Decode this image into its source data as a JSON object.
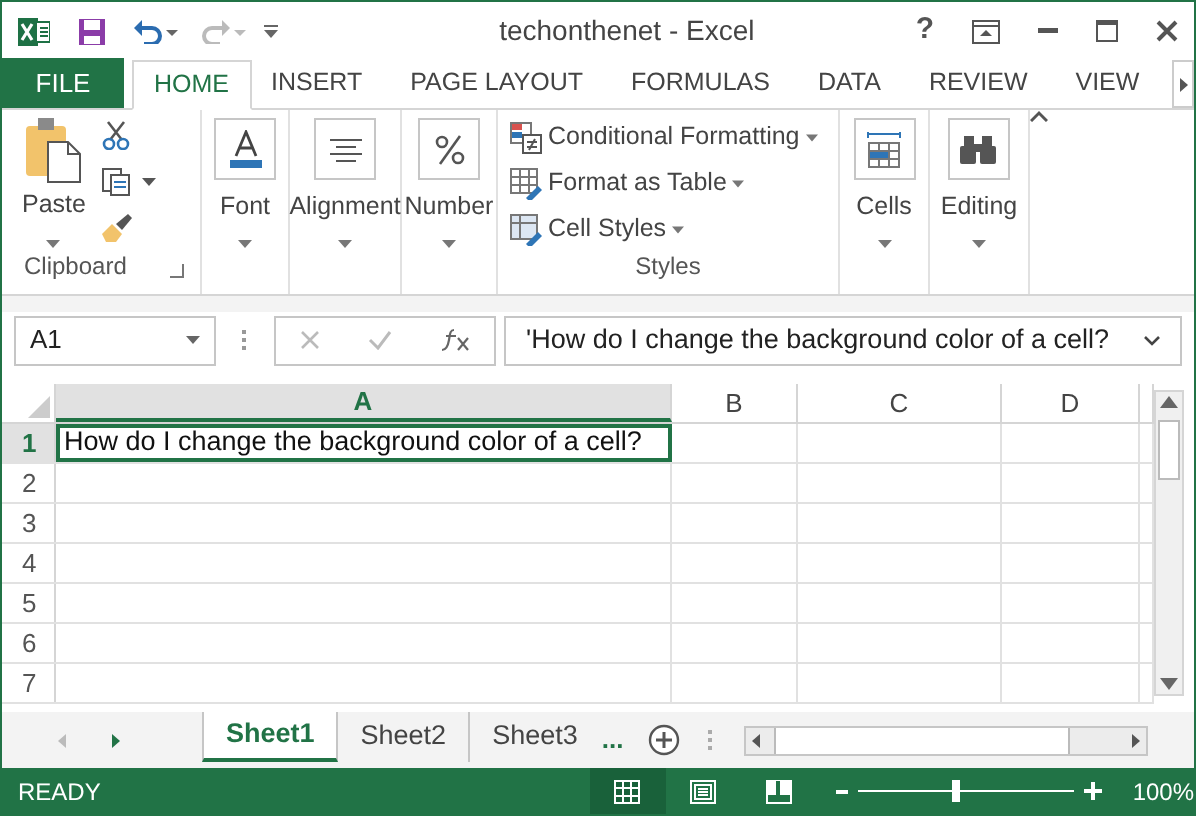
{
  "window": {
    "title": "techonthenet - Excel",
    "help": "?"
  },
  "ribbon_tabs": [
    {
      "label": "FILE",
      "kind": "file",
      "selected": false
    },
    {
      "label": "HOME",
      "kind": "tab",
      "selected": true
    },
    {
      "label": "INSERT",
      "kind": "tab",
      "selected": false
    },
    {
      "label": "PAGE LAYOUT",
      "kind": "tab",
      "selected": false
    },
    {
      "label": "FORMULAS",
      "kind": "tab",
      "selected": false
    },
    {
      "label": "DATA",
      "kind": "tab",
      "selected": false
    },
    {
      "label": "REVIEW",
      "kind": "tab",
      "selected": false
    },
    {
      "label": "VIEW",
      "kind": "tab",
      "selected": false
    }
  ],
  "ribbon_groups": [
    {
      "kind": "clipboard",
      "label": "Clipboard",
      "button": "Paste"
    },
    {
      "kind": "font",
      "button": "Font"
    },
    {
      "kind": "alignment",
      "button": "Alignment"
    },
    {
      "kind": "number",
      "button": "Number"
    },
    {
      "kind": "styles",
      "label": "Styles",
      "items": [
        "Conditional Formatting",
        "Format as Table",
        "Cell Styles"
      ]
    },
    {
      "kind": "cells",
      "button": "Cells"
    },
    {
      "kind": "editing",
      "button": "Editing"
    }
  ],
  "formula_bar": {
    "name_box": "A1",
    "formula": "'How do I change the background color of a cell?"
  },
  "columns": [
    {
      "label": "A",
      "selected": true
    },
    {
      "label": "B",
      "selected": false
    },
    {
      "label": "C",
      "selected": false
    },
    {
      "label": "D",
      "selected": false
    }
  ],
  "rows": [
    {
      "header": "1",
      "selected": true,
      "cells": [
        "How do I change the background color of a cell?"
      ]
    },
    {
      "header": "2",
      "selected": false,
      "cells": []
    },
    {
      "header": "3",
      "selected": false,
      "cells": []
    },
    {
      "header": "4",
      "selected": false,
      "cells": []
    },
    {
      "header": "5",
      "selected": false,
      "cells": []
    },
    {
      "header": "6",
      "selected": false,
      "cells": []
    },
    {
      "header": "7",
      "selected": false,
      "cells": []
    }
  ],
  "sheets": [
    {
      "label": "Sheet1",
      "selected": true
    },
    {
      "label": "Sheet2",
      "selected": false
    },
    {
      "label": "Sheet3",
      "selected": false
    }
  ],
  "sheet_overflow": "...",
  "status_bar": {
    "text": "READY",
    "views": [
      {
        "kind": "normal",
        "selected": true
      },
      {
        "kind": "page_layout",
        "selected": false
      },
      {
        "kind": "page_break",
        "selected": false
      }
    ],
    "zoom": {
      "level": 0.45,
      "reading": "100%"
    }
  }
}
